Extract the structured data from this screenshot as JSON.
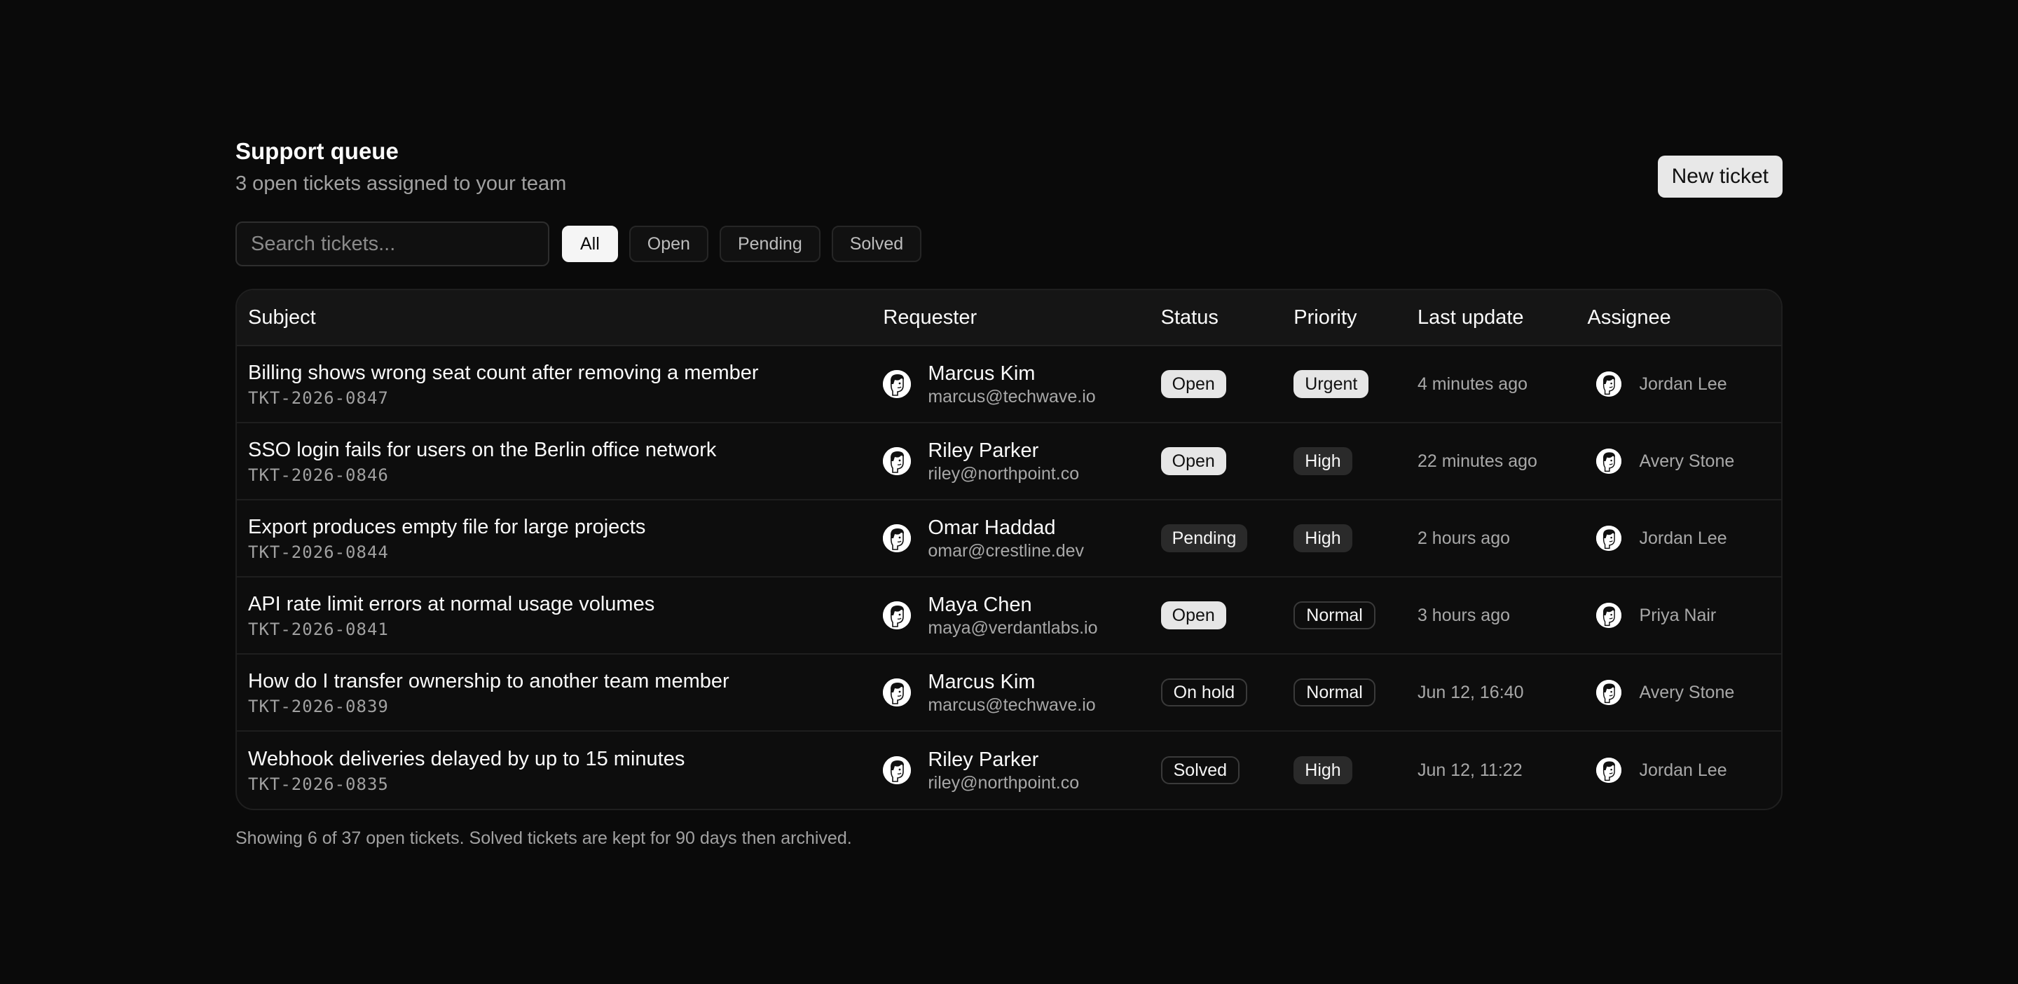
{
  "header": {
    "title": "Support queue",
    "subtitle": "3 open tickets assigned to your team",
    "new_ticket_label": "New ticket"
  },
  "search": {
    "placeholder": "Search tickets..."
  },
  "filters": [
    {
      "label": "All",
      "active": true
    },
    {
      "label": "Open",
      "active": false
    },
    {
      "label": "Pending",
      "active": false
    },
    {
      "label": "Solved",
      "active": false
    }
  ],
  "table": {
    "columns": [
      "Subject",
      "Requester",
      "Status",
      "Priority",
      "Last update",
      "Assignee"
    ],
    "rows": [
      {
        "subject": "Billing shows wrong seat count after removing a member",
        "id": "TKT-2026-0847",
        "requester": {
          "name": "Marcus Kim",
          "email": "marcus@techwave.io"
        },
        "status": {
          "label": "Open",
          "style": "light"
        },
        "priority": {
          "label": "Urgent",
          "style": "light"
        },
        "last_update": "4 minutes ago",
        "assignee": "Jordan Lee"
      },
      {
        "subject": "SSO login fails for users on the Berlin office network",
        "id": "TKT-2026-0846",
        "requester": {
          "name": "Riley Parker",
          "email": "riley@northpoint.co"
        },
        "status": {
          "label": "Open",
          "style": "light"
        },
        "priority": {
          "label": "High",
          "style": "dark"
        },
        "last_update": "22 minutes ago",
        "assignee": "Avery Stone"
      },
      {
        "subject": "Export produces empty file for large projects",
        "id": "TKT-2026-0844",
        "requester": {
          "name": "Omar Haddad",
          "email": "omar@crestline.dev"
        },
        "status": {
          "label": "Pending",
          "style": "dark"
        },
        "priority": {
          "label": "High",
          "style": "dark"
        },
        "last_update": "2 hours ago",
        "assignee": "Jordan Lee"
      },
      {
        "subject": "API rate limit errors at normal usage volumes",
        "id": "TKT-2026-0841",
        "requester": {
          "name": "Maya Chen",
          "email": "maya@verdantlabs.io"
        },
        "status": {
          "label": "Open",
          "style": "light"
        },
        "priority": {
          "label": "Normal",
          "style": "outline"
        },
        "last_update": "3 hours ago",
        "assignee": "Priya Nair"
      },
      {
        "subject": "How do I transfer ownership to another team member",
        "id": "TKT-2026-0839",
        "requester": {
          "name": "Marcus Kim",
          "email": "marcus@techwave.io"
        },
        "status": {
          "label": "On hold",
          "style": "outline"
        },
        "priority": {
          "label": "Normal",
          "style": "outline"
        },
        "last_update": "Jun 12, 16:40",
        "assignee": "Avery Stone"
      },
      {
        "subject": "Webhook deliveries delayed by up to 15 minutes",
        "id": "TKT-2026-0835",
        "requester": {
          "name": "Riley Parker",
          "email": "riley@northpoint.co"
        },
        "status": {
          "label": "Solved",
          "style": "outline"
        },
        "priority": {
          "label": "High",
          "style": "dark"
        },
        "last_update": "Jun 12, 11:22",
        "assignee": "Jordan Lee"
      }
    ]
  },
  "footer": {
    "note": "Showing 6 of 37 open tickets. Solved tickets are kept for 90 days then archived."
  }
}
